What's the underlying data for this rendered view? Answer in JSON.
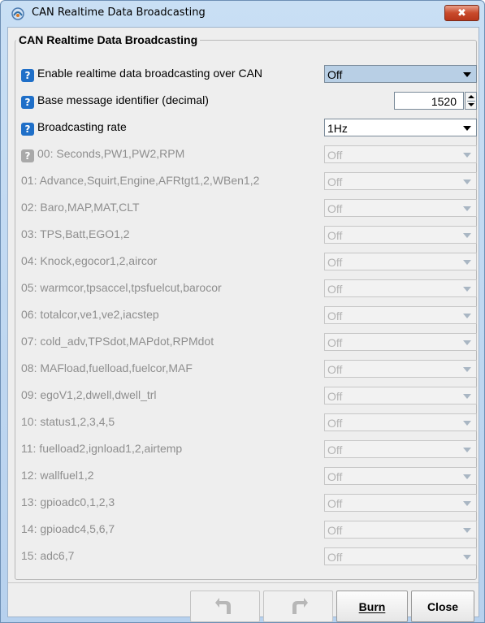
{
  "window": {
    "title": "CAN Realtime Data Broadcasting",
    "close_label": "✖"
  },
  "group": {
    "title": "CAN Realtime Data Broadcasting"
  },
  "settings": {
    "enable": {
      "label": "Enable realtime data broadcasting over CAN",
      "value": "Off"
    },
    "base_id": {
      "label": "Base message identifier (decimal)",
      "value": "1520"
    },
    "rate": {
      "label": "Broadcasting rate",
      "value": "1Hz"
    }
  },
  "messages": [
    {
      "label": "00: Seconds,PW1,PW2,RPM",
      "value": "Off"
    },
    {
      "label": "01: Advance,Squirt,Engine,AFRtgt1,2,WBen1,2",
      "value": "Off"
    },
    {
      "label": "02: Baro,MAP,MAT,CLT",
      "value": "Off"
    },
    {
      "label": "03: TPS,Batt,EGO1,2",
      "value": "Off"
    },
    {
      "label": "04: Knock,egocor1,2,aircor",
      "value": "Off"
    },
    {
      "label": "05: warmcor,tpsaccel,tpsfuelcut,barocor",
      "value": "Off"
    },
    {
      "label": "06: totalcor,ve1,ve2,iacstep",
      "value": "Off"
    },
    {
      "label": "07: cold_adv,TPSdot,MAPdot,RPMdot",
      "value": "Off"
    },
    {
      "label": "08: MAFload,fuelload,fuelcor,MAF",
      "value": "Off"
    },
    {
      "label": "09: egoV1,2,dwell,dwell_trl",
      "value": "Off"
    },
    {
      "label": "10: status1,2,3,4,5",
      "value": "Off"
    },
    {
      "label": "11: fuelload2,ignload1,2,airtemp",
      "value": "Off"
    },
    {
      "label": "12: wallfuel1,2",
      "value": "Off"
    },
    {
      "label": "13: gpioadc0,1,2,3",
      "value": "Off"
    },
    {
      "label": "14: gpioadc4,5,6,7",
      "value": "Off"
    },
    {
      "label": "15: adc6,7",
      "value": "Off"
    }
  ],
  "footer": {
    "burn_label": "Burn",
    "close_label": "Close"
  },
  "colors": {
    "help_icon": "#1f6fc8",
    "highlight_combo": "#b8cfe5",
    "disabled_text": "#8e8e8e"
  }
}
